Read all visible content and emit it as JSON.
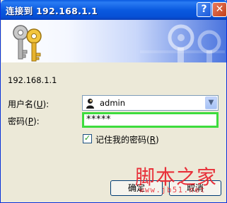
{
  "window": {
    "title": "连接到 192.168.1.1",
    "help_label": "?",
    "close_label": "✕"
  },
  "host": {
    "text": "192.168.1.1"
  },
  "username": {
    "label": "用户名",
    "accesskey": "U",
    "value": "admin"
  },
  "password": {
    "label": "密码",
    "accesskey": "P",
    "value": "*****"
  },
  "remember": {
    "checked": true,
    "label": "记住我的密码",
    "accesskey": "R"
  },
  "buttons": {
    "ok_label": "确定",
    "cancel_label": "取消"
  },
  "watermark": {
    "text": "脚本之家",
    "url": "www.jb51.net"
  },
  "colors": {
    "titlebar": "#0a5ae0",
    "focus_border": "#3ddc3d",
    "watermark": "#e8212c"
  },
  "icons": [
    "keys-icon",
    "user-icon",
    "chevron-down-icon",
    "help-icon",
    "close-icon"
  ]
}
